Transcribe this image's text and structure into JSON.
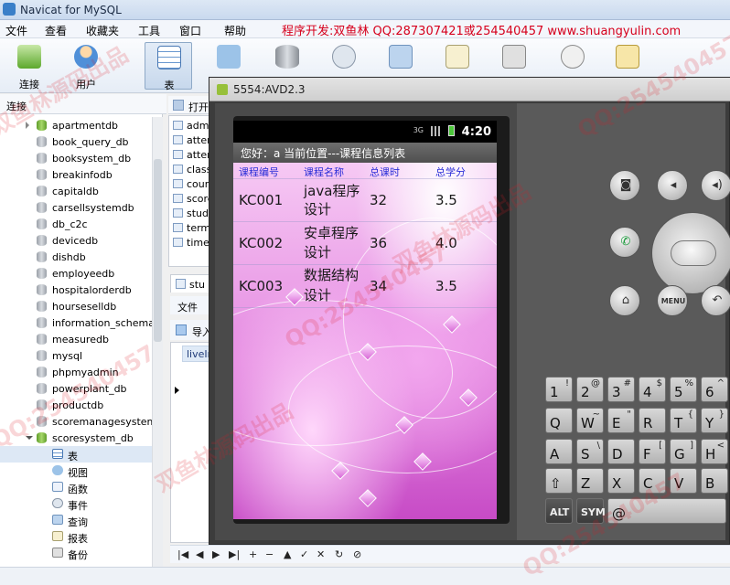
{
  "window": {
    "title": "Navicat for MySQL"
  },
  "menubar": {
    "items": [
      "文件",
      "查看",
      "收藏夹",
      "工具",
      "窗口",
      "帮助"
    ],
    "promo": "程序开发:双鱼林 QQ:287307421或254540457 www.shuangyulin.com"
  },
  "toolbar": {
    "connect": "连接",
    "user": "用户",
    "table": "表"
  },
  "sidebar": {
    "header": "连接",
    "databases": [
      "apartmentdb",
      "book_query_db",
      "booksystem_db",
      "breakinfodb",
      "capitaldb",
      "carsellsystemdb",
      "db_c2c",
      "devicedb",
      "dishdb",
      "employeedb",
      "hospitalorderdb",
      "hourseselldb",
      "information_schema",
      "measuredb",
      "mysql",
      "phpmyadmin",
      "powerplant_db",
      "productdb",
      "scoremanagesystem",
      "scoresystem_db"
    ],
    "children": [
      "表",
      "视图",
      "函数",
      "事件",
      "查询",
      "报表",
      "备份"
    ]
  },
  "object_pane": {
    "open_label": "打开",
    "items": [
      "admi",
      "atten",
      "atten",
      "class",
      "cours",
      "score",
      "stude",
      "termi",
      "timei"
    ],
    "tab": "stu",
    "file_menu": "文件",
    "import": "导入",
    "cell": "liveIn"
  },
  "navbar": {
    "buttons": [
      "|◀",
      "◀",
      "▶",
      "▶|",
      "+",
      "−",
      "▲",
      "✓",
      "✕",
      "↻",
      "⊘"
    ]
  },
  "emulator": {
    "title": "5554:AVD2.3",
    "time": "4:20",
    "network": "3G",
    "header_text": "您好：a   当前位置---课程信息列表",
    "columns": [
      "课程编号",
      "课程名称",
      "总课时",
      "总学分"
    ],
    "rows": [
      {
        "id": "KC001",
        "name1": "java程序",
        "name2": "设计",
        "hours": "32",
        "credit": "3.5"
      },
      {
        "id": "KC002",
        "name1": "安卓程序",
        "name2": "设计",
        "hours": "36",
        "credit": "4.0"
      },
      {
        "id": "KC003",
        "name1": "数据结构",
        "name2": "设计",
        "hours": "34",
        "credit": "3.5"
      }
    ],
    "menu_key": "MENU",
    "keys_row1": [
      [
        "1",
        "!"
      ],
      [
        "2",
        "@"
      ],
      [
        "3",
        "#"
      ],
      [
        "4",
        "$"
      ],
      [
        "5",
        "%"
      ],
      [
        "6",
        "^"
      ]
    ],
    "keys_row2": [
      "Q",
      "W",
      "E",
      "R",
      "T",
      "Y"
    ],
    "keys_row2_sub": [
      "",
      "~",
      "\"",
      "",
      "{",
      "}"
    ],
    "keys_row3": [
      "A",
      "S",
      "D",
      "F",
      "G",
      "H"
    ],
    "keys_row3_sub": [
      "",
      "\\",
      "",
      "[",
      "]",
      "<"
    ],
    "keys_row4": [
      "⇧",
      "Z",
      "X",
      "C",
      "V",
      "B"
    ],
    "keys_row5": [
      "ALT",
      "SYM",
      "@"
    ]
  },
  "watermark": {
    "qq": "QQ:254540457",
    "cn": "双鱼林源码出品"
  }
}
